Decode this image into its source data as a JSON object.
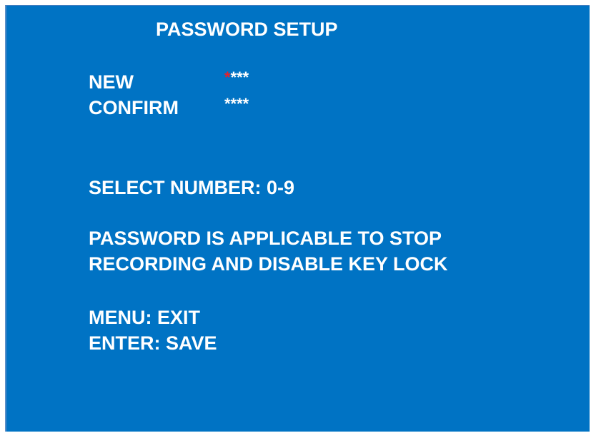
{
  "screen": {
    "title": "PASSWORD SETUP",
    "background_color": "#0073c4",
    "text_color": "#ffffff",
    "cursor_color": "#e8202a"
  },
  "fields": {
    "new": {
      "label": "NEW",
      "cursor_char": "*",
      "rest_chars": "***"
    },
    "confirm": {
      "label": "CONFIRM",
      "value": "****"
    }
  },
  "instructions": {
    "select_number": "SELECT NUMBER: 0-9",
    "note_line1": "PASSWORD IS APPLICABLE TO STOP",
    "note_line2": "RECORDING AND DISABLE KEY LOCK",
    "menu_exit": "MENU: EXIT",
    "enter_save": "ENTER: SAVE"
  }
}
